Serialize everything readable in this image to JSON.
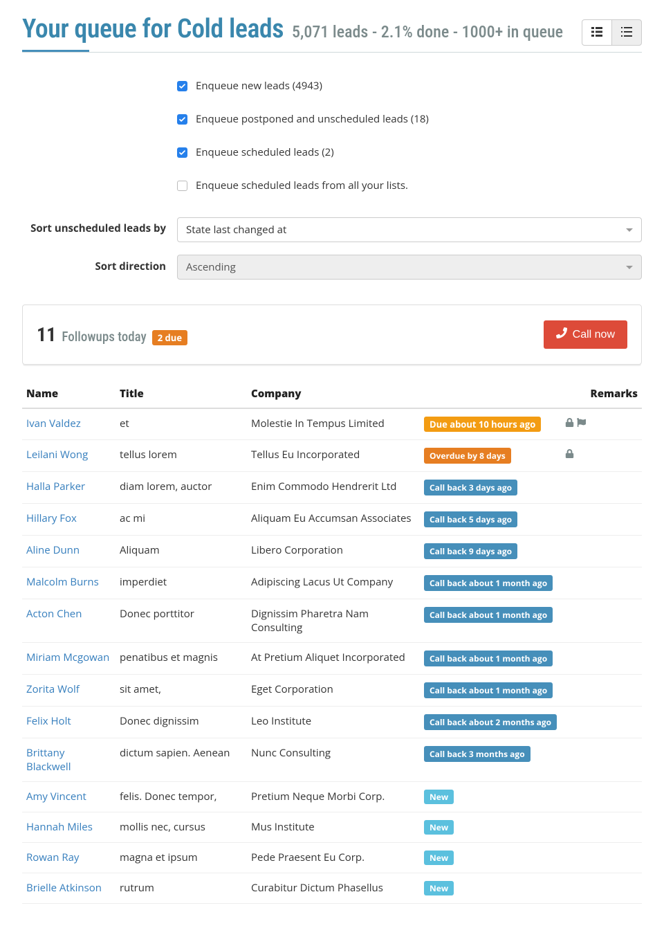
{
  "header": {
    "title": "Your queue for Cold leads",
    "subtitle": "5,071 leads - 2.1% done - 1000+ in queue"
  },
  "filters": {
    "checkboxes": [
      {
        "label": "Enqueue new leads (4943)",
        "checked": true
      },
      {
        "label": "Enqueue postponed and unscheduled leads (18)",
        "checked": true
      },
      {
        "label": "Enqueue scheduled leads (2)",
        "checked": true
      },
      {
        "label": "Enqueue scheduled leads from all your lists.",
        "checked": false
      }
    ],
    "sort_by_label": "Sort unscheduled leads by",
    "sort_by_value": "State last changed at",
    "sort_dir_label": "Sort direction",
    "sort_dir_value": "Ascending"
  },
  "panel": {
    "count": "11",
    "label": "Followups today",
    "due_badge": "2 due",
    "call_now": "Call now"
  },
  "table": {
    "headers": {
      "name": "Name",
      "title": "Title",
      "company": "Company",
      "remarks": "Remarks"
    },
    "rows": [
      {
        "name": "Ivan Valdez",
        "title": "et",
        "company": "Molestie In Tempus Limited",
        "status": "Due about 10 hours ago",
        "status_type": "warning",
        "icons": [
          "lock",
          "flag"
        ]
      },
      {
        "name": "Leilani Wong",
        "title": "tellus lorem",
        "company": "Tellus Eu Incorporated",
        "status": "Overdue by 8 days",
        "status_type": "overdue",
        "icons": [
          "lock"
        ]
      },
      {
        "name": "Halla Parker",
        "title": "diam lorem, auctor",
        "company": "Enim Commodo Hendrerit Ltd",
        "status": "Call back 3 days ago",
        "status_type": "callback",
        "icons": []
      },
      {
        "name": "Hillary Fox",
        "title": "ac mi",
        "company": "Aliquam Eu Accumsan Associates",
        "status": "Call back 5 days ago",
        "status_type": "callback",
        "icons": []
      },
      {
        "name": "Aline Dunn",
        "title": "Aliquam",
        "company": "Libero Corporation",
        "status": "Call back 9 days ago",
        "status_type": "callback",
        "icons": []
      },
      {
        "name": "Malcolm Burns",
        "title": "imperdiet",
        "company": "Adipiscing Lacus Ut Company",
        "status": "Call back about 1 month ago",
        "status_type": "callback",
        "icons": []
      },
      {
        "name": "Acton Chen",
        "title": "Donec porttitor",
        "company": "Dignissim Pharetra Nam Consulting",
        "status": "Call back about 1 month ago",
        "status_type": "callback",
        "icons": []
      },
      {
        "name": "Miriam Mcgowan",
        "title": "penatibus et magnis",
        "company": "At Pretium Aliquet Incorporated",
        "status": "Call back about 1 month ago",
        "status_type": "callback",
        "icons": []
      },
      {
        "name": "Zorita Wolf",
        "title": "sit amet,",
        "company": "Eget Corporation",
        "status": "Call back about 1 month ago",
        "status_type": "callback",
        "icons": []
      },
      {
        "name": "Felix Holt",
        "title": "Donec dignissim",
        "company": "Leo Institute",
        "status": "Call back about 2 months ago",
        "status_type": "callback",
        "icons": []
      },
      {
        "name": "Brittany Blackwell",
        "title": "dictum sapien. Aenean",
        "company": "Nunc Consulting",
        "status": "Call back 3 months ago",
        "status_type": "callback",
        "icons": []
      },
      {
        "name": "Amy Vincent",
        "title": "felis. Donec tempor,",
        "company": "Pretium Neque Morbi Corp.",
        "status": "New",
        "status_type": "new",
        "icons": []
      },
      {
        "name": "Hannah Miles",
        "title": "mollis nec, cursus",
        "company": "Mus Institute",
        "status": "New",
        "status_type": "new",
        "icons": []
      },
      {
        "name": "Rowan Ray",
        "title": "magna et ipsum",
        "company": "Pede Praesent Eu Corp.",
        "status": "New",
        "status_type": "new",
        "icons": []
      },
      {
        "name": "Brielle Atkinson",
        "title": "rutrum",
        "company": "Curabitur Dictum Phasellus",
        "status": "New",
        "status_type": "new",
        "icons": []
      }
    ]
  }
}
